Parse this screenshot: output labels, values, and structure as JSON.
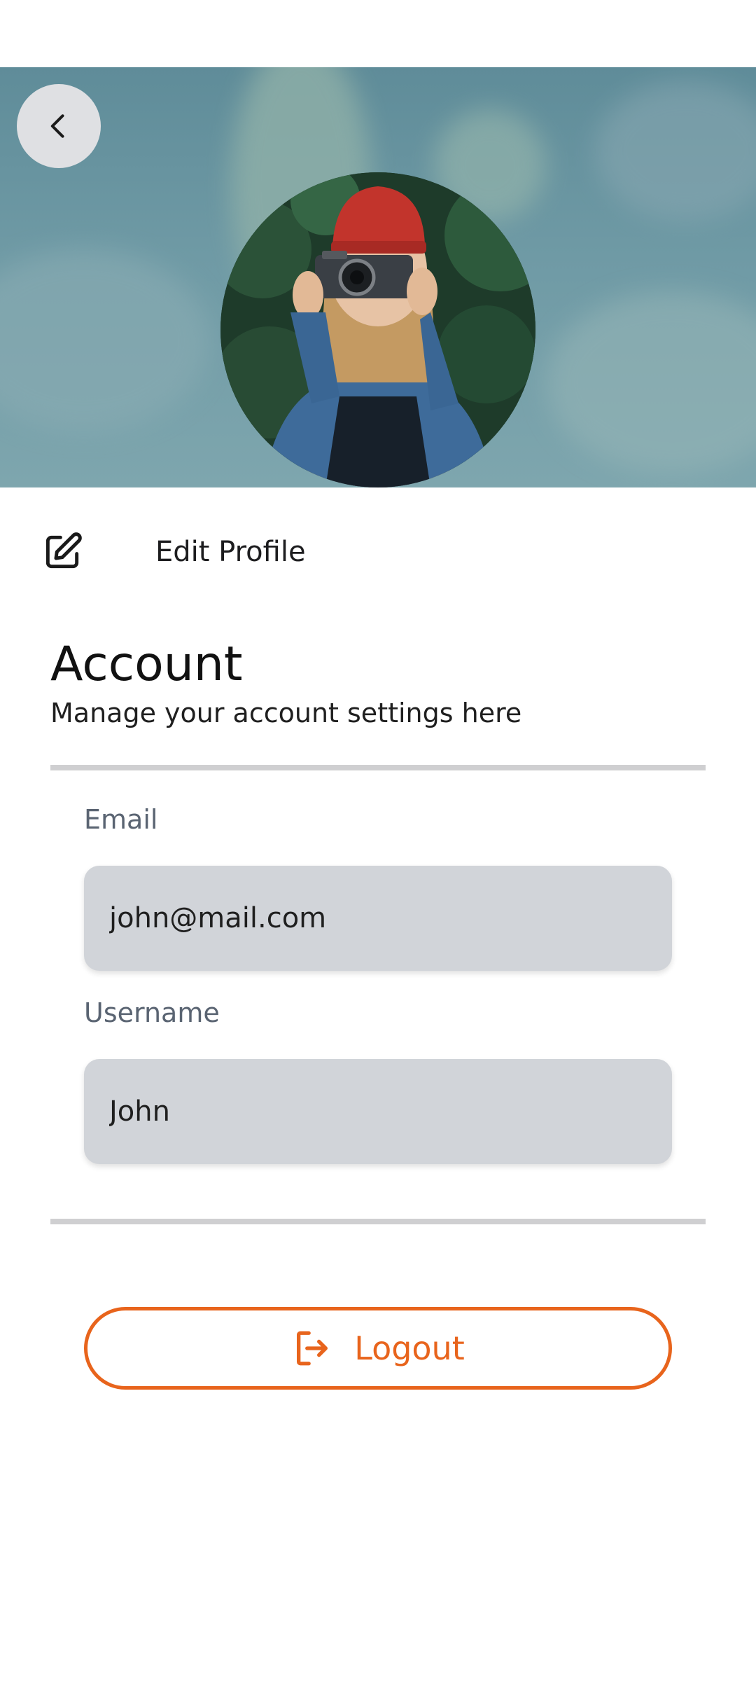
{
  "header": {
    "back_icon": "chevron-left-icon",
    "avatar_alt": "Profile photo"
  },
  "profile": {
    "edit_label": "Edit Profile",
    "edit_icon": "edit-icon"
  },
  "account": {
    "title": "Account",
    "subtitle": "Manage your account settings here",
    "email_label": "Email",
    "email_value": "john@mail.com",
    "username_label": "Username",
    "username_value": "John"
  },
  "logout": {
    "label": "Logout",
    "icon": "logout-icon"
  },
  "colors": {
    "accent": "#e8641c",
    "field_bg": "#d1d4d9",
    "divider": "#cfcfd1",
    "back_button_bg": "#dfe0e3"
  }
}
